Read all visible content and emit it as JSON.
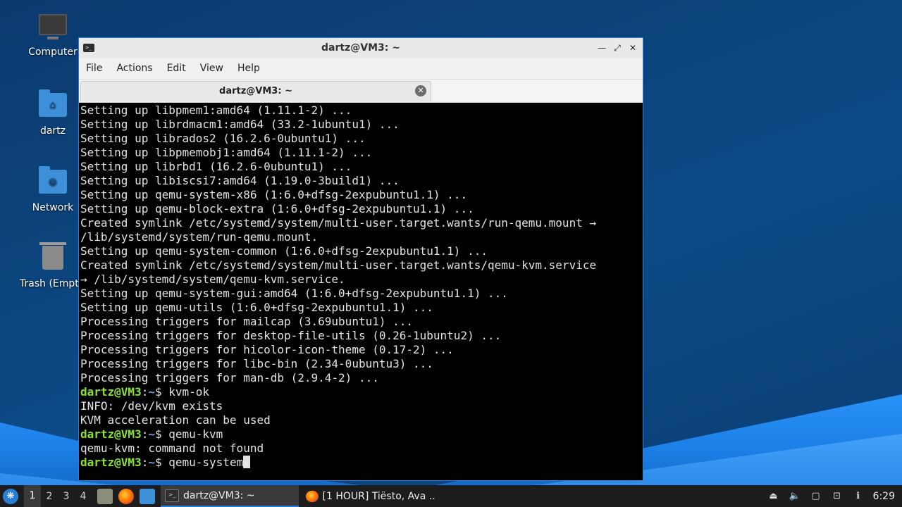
{
  "desktop": {
    "icons": [
      {
        "label": "Computer"
      },
      {
        "label": "dartz"
      },
      {
        "label": "Network"
      },
      {
        "label": "Trash (Empty)"
      }
    ]
  },
  "window": {
    "title": "dartz@VM3: ~",
    "menu": [
      "File",
      "Actions",
      "Edit",
      "View",
      "Help"
    ],
    "tab_label": "dartz@VM3: ~"
  },
  "terminal": {
    "output_lines": [
      "Setting up libpmem1:amd64 (1.11.1-2) ...",
      "Setting up librdmacm1:amd64 (33.2-1ubuntu1) ...",
      "Setting up librados2 (16.2.6-0ubuntu1) ...",
      "Setting up libpmemobj1:amd64 (1.11.1-2) ...",
      "Setting up librbd1 (16.2.6-0ubuntu1) ...",
      "Setting up libiscsi7:amd64 (1.19.0-3build1) ...",
      "Setting up qemu-system-x86 (1:6.0+dfsg-2expubuntu1.1) ...",
      "Setting up qemu-block-extra (1:6.0+dfsg-2expubuntu1.1) ...",
      "Created symlink /etc/systemd/system/multi-user.target.wants/run-qemu.mount →",
      "/lib/systemd/system/run-qemu.mount.",
      "Setting up qemu-system-common (1:6.0+dfsg-2expubuntu1.1) ...",
      "Created symlink /etc/systemd/system/multi-user.target.wants/qemu-kvm.service",
      "→ /lib/systemd/system/qemu-kvm.service.",
      "Setting up qemu-system-gui:amd64 (1:6.0+dfsg-2expubuntu1.1) ...",
      "Setting up qemu-utils (1:6.0+dfsg-2expubuntu1.1) ...",
      "Processing triggers for mailcap (3.69ubuntu1) ...",
      "Processing triggers for desktop-file-utils (0.26-1ubuntu2) ...",
      "Processing triggers for hicolor-icon-theme (0.17-2) ...",
      "Processing triggers for libc-bin (2.34-0ubuntu3) ...",
      "Processing triggers for man-db (2.9.4-2) ..."
    ],
    "prompt_user": "dartz@VM3",
    "prompt_sep": ":",
    "prompt_path": "~",
    "prompt_dollar": "$ ",
    "cmd1": "kvm-ok",
    "cmd1_output": [
      "INFO: /dev/kvm exists",
      "KVM acceleration can be used"
    ],
    "cmd2": "qemu-kvm",
    "cmd2_output": [
      "qemu-kvm: command not found"
    ],
    "current_input": "qemu-system"
  },
  "taskbar": {
    "workspaces": [
      "1",
      "2",
      "3",
      "4"
    ],
    "tasks": [
      {
        "label": "dartz@VM3: ~"
      },
      {
        "label": "[1 HOUR] Tiësto, Ava ..."
      }
    ],
    "clock": "6:29"
  }
}
